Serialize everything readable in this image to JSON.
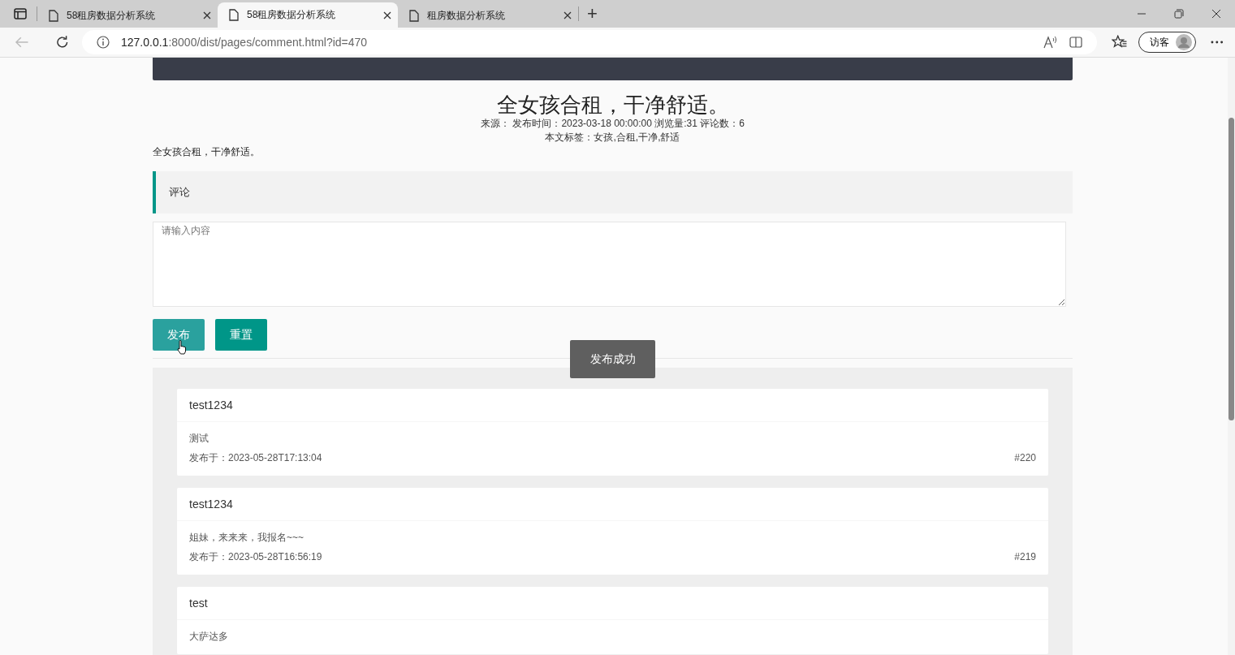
{
  "browser": {
    "tabs": [
      {
        "title": "58租房数据分析系统",
        "selected": false
      },
      {
        "title": "58租房数据分析系统",
        "selected": true
      },
      {
        "title": "租房数据分析系统",
        "selected": false
      }
    ],
    "new_tab": "+",
    "url_host": "127.0.0.1",
    "url_rest": ":8000/dist/pages/comment.html?id=470",
    "profile": "访客"
  },
  "article": {
    "title": "全女孩合租，干净舒适。",
    "meta": "来源：  发布时间：2023-03-18 00:00:00 浏览量:31 评论数：6",
    "tags": "本文标签：女孩,合租,干净,舒适",
    "body": "全女孩合租，干净舒适。"
  },
  "comment_form": {
    "heading": "评论",
    "placeholder": "请输入内容",
    "buttons": [
      {
        "label": "发布",
        "hovered": true
      },
      {
        "label": "重置",
        "hovered": false
      }
    ]
  },
  "toast": "发布成功",
  "comments": [
    {
      "user": "test1234",
      "content": "测试",
      "date": "发布于：2023-05-28T17:13:04",
      "number": "#220"
    },
    {
      "user": "test1234",
      "content": "姐妹，来来来，我报名~~~",
      "date": "发布于：2023-05-28T16:56:19",
      "number": "#219"
    },
    {
      "user": "test",
      "content": "大萨达多"
    }
  ]
}
